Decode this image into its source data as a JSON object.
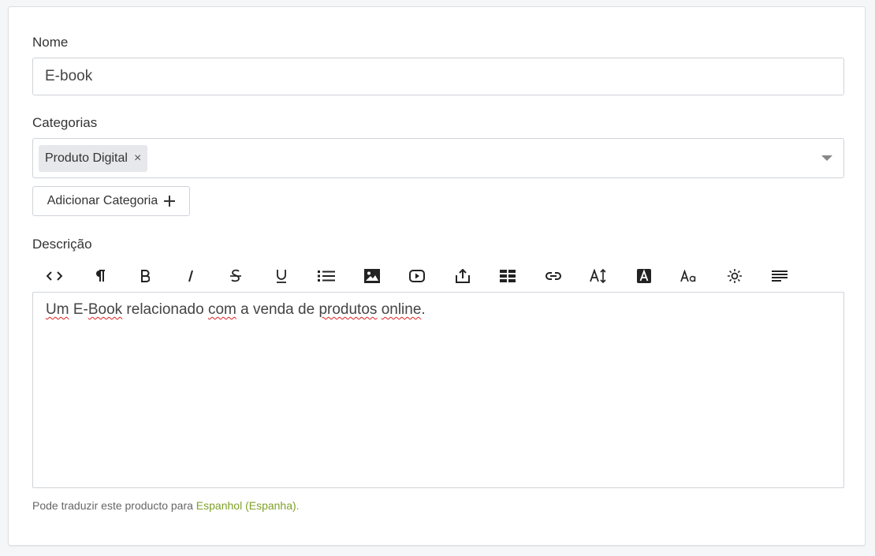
{
  "form": {
    "name": {
      "label": "Nome",
      "value": "E-book"
    },
    "categories": {
      "label": "Categorias",
      "selected": [
        {
          "label": "Produto Digital",
          "remove": "×"
        }
      ],
      "add_button": "Adicionar Categoria"
    },
    "description": {
      "label": "Descrição",
      "toolbar": [
        "code-view",
        "paragraph",
        "bold",
        "italic",
        "strikethrough",
        "underline",
        "list",
        "image",
        "video",
        "upload",
        "table",
        "link",
        "line-height",
        "text-color",
        "font-size",
        "special",
        "align"
      ],
      "content": {
        "segments": [
          {
            "text": "Um",
            "spell": true
          },
          {
            "text": " E-",
            "spell": false
          },
          {
            "text": "Book",
            "spell": true
          },
          {
            "text": " relacionado ",
            "spell": false
          },
          {
            "text": "com",
            "spell": true
          },
          {
            "text": " a venda de ",
            "spell": false
          },
          {
            "text": "produtos",
            "spell": true
          },
          {
            "text": " ",
            "spell": false
          },
          {
            "text": "online",
            "spell": true
          },
          {
            "text": ".",
            "spell": false
          }
        ]
      }
    },
    "translation_hint": {
      "text": "Pode traduzir este producto para ",
      "link": "Espanhol (Espanha)",
      "suffix": "."
    }
  },
  "colors": {
    "accent_link": "#7fa12a",
    "border": "#cfd3d8",
    "chip": "#e6e8eb"
  }
}
